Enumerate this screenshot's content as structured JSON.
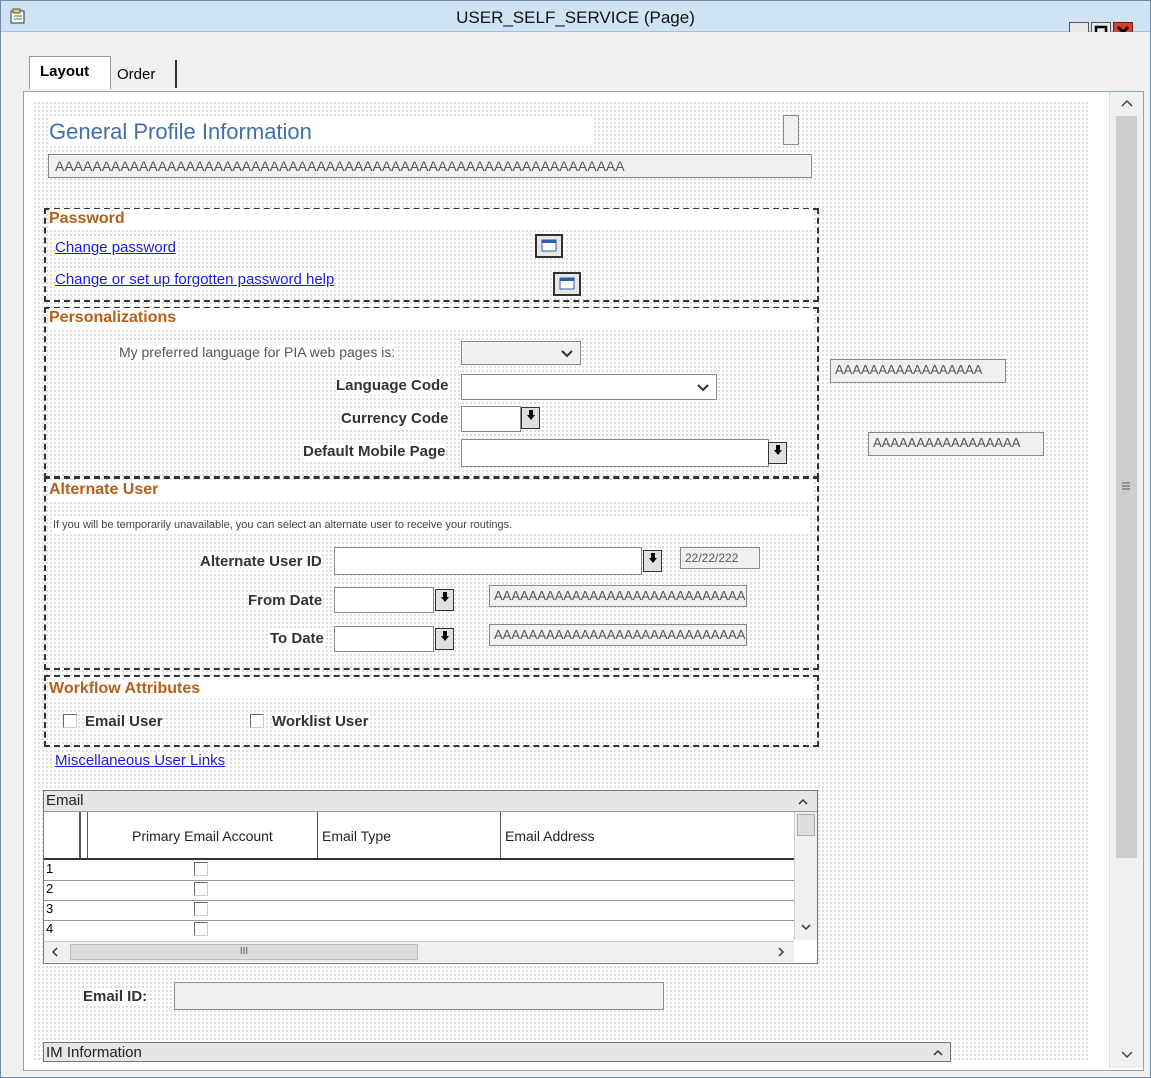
{
  "window": {
    "title": "USER_SELF_SERVICE (Page)"
  },
  "tabs": [
    {
      "label": "Layout"
    },
    {
      "label": "Order"
    }
  ],
  "page": {
    "title": "General Profile Information",
    "header_field": "AAAAAAAAAAAAAAAAAAAAAAAAAAAAAAAAAAAAAAAAAAAAAAAAAAAAAAAAAAAAA",
    "password": {
      "title": "Password",
      "change_link": "Change password",
      "forgotten_link": "Change or set up forgotten password help"
    },
    "personalizations": {
      "title": "Personalizations",
      "pref_lang_label": "My preferred language for PIA web pages is:",
      "language_code_label": "Language Code",
      "currency_code_label": "Currency Code",
      "default_mobile_label": "Default Mobile Page",
      "lang_desc": "AAAAAAAAAAAAAAAAA",
      "mobile_desc": "AAAAAAAAAAAAAAAAA"
    },
    "alternate_user": {
      "title": "Alternate User",
      "info": "If you will be temporarily unavailable, you can select an alternate user to receive your routings.",
      "user_id_label": "Alternate User ID",
      "user_id_date": "22/22/222",
      "from_label": "From Date",
      "to_label": "To Date",
      "from_desc": "AAAAAAAAAAAAAAAAAAAAAAAAAAAAA",
      "to_desc": "AAAAAAAAAAAAAAAAAAAAAAAAAAAAA"
    },
    "workflow": {
      "title": "Workflow Attributes",
      "email_user": "Email User",
      "worklist_user": "Worklist User"
    },
    "misc_link": "Miscellaneous User Links",
    "email_grid": {
      "title": "Email",
      "columns": [
        "Primary Email Account",
        "Email Type",
        "Email Address"
      ],
      "rows": [
        "1",
        "2",
        "3",
        "4"
      ],
      "hscroll_glyph": "III"
    },
    "email_id_label": "Email ID:",
    "im_grid_title": "IM Information"
  }
}
